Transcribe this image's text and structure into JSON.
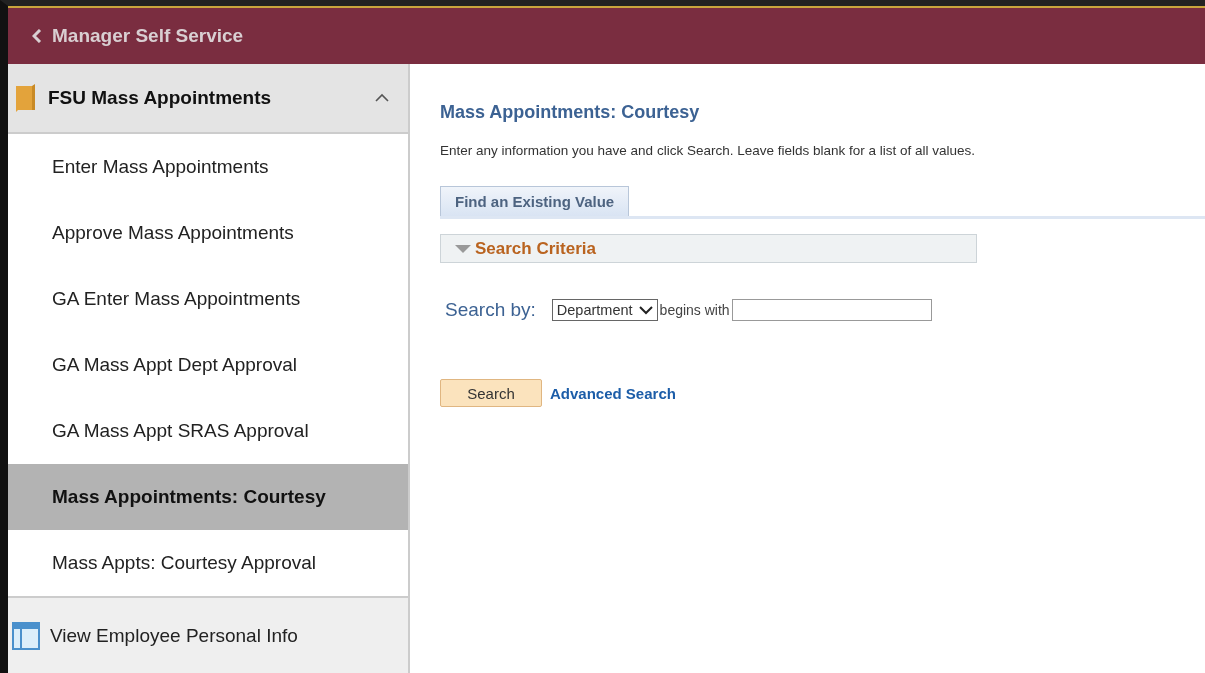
{
  "header": {
    "back_label": "Manager Self Service"
  },
  "sidebar": {
    "group": {
      "label": "FSU Mass Appointments",
      "expanded": true
    },
    "items": [
      {
        "label": "Enter Mass Appointments",
        "selected": false
      },
      {
        "label": "Approve Mass Appointments",
        "selected": false
      },
      {
        "label": "GA Enter Mass Appointments",
        "selected": false
      },
      {
        "label": "GA Mass Appt Dept Approval",
        "selected": false
      },
      {
        "label": "GA Mass Appt SRAS Approval",
        "selected": false
      },
      {
        "label": "Mass Appointments: Courtesy",
        "selected": true
      },
      {
        "label": "Mass Appts: Courtesy Approval",
        "selected": false
      }
    ],
    "footer_item": {
      "label": "View Employee Personal Info"
    }
  },
  "content": {
    "title": "Mass Appointments: Courtesy",
    "instructions": "Enter any information you have and click Search. Leave fields blank for a list of all values.",
    "tabs": [
      {
        "label": "Find an Existing Value",
        "selected": true
      }
    ],
    "section": {
      "label": "Search Criteria",
      "expanded": true
    },
    "search_by": {
      "label": "Search by:",
      "field": "Department",
      "operator": "begins with"
    },
    "buttons": [
      {
        "label": "Search",
        "kind": "button"
      },
      {
        "label": "Advanced Search",
        "kind": "link"
      }
    ]
  }
}
